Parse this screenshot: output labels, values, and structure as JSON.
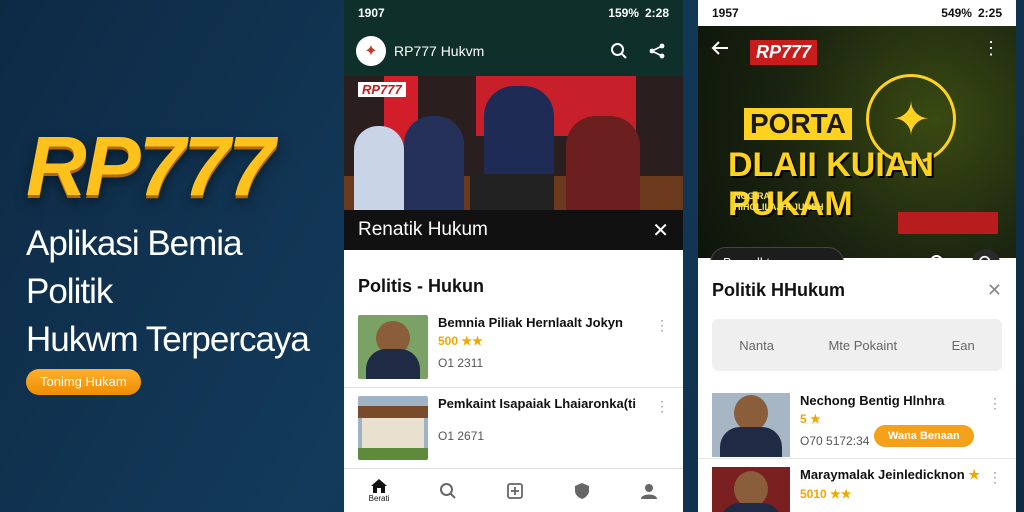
{
  "hero": {
    "logo": "RP777",
    "tagline_line1": "Aplikasi Bemia Politik",
    "tagline_line2": "Hukwm Terpercaya",
    "button": "Tonimg Hukam"
  },
  "phone1": {
    "status_time": "1907",
    "status_right": "159%",
    "status_clock": "2:28",
    "app_title": "RP777 Hukvm",
    "image_sign": "RP777",
    "caption": "Renatik Hukum",
    "list_title": "Politis - Hukun",
    "items": [
      {
        "title": "Bemnia Piliak Hernlaalt Jokyn",
        "rating": "500",
        "meta": "O1 2311"
      },
      {
        "title": "Pemkaint Isapaiak Lhaiaronka(ti",
        "rating": "",
        "meta": "O1 2671"
      }
    ],
    "nav": [
      "Berati",
      "",
      "",
      "",
      ""
    ]
  },
  "phone2": {
    "status_time": "1957",
    "status_right": "549%",
    "status_clock": "2:25",
    "logo": "RP777",
    "banner_porta": "PORTA",
    "banner_main": "DLAII KUIAN PUKAM",
    "banner_small1": "NOGIRA",
    "banner_small2": "HIHOLILAJHI JUNEH",
    "search_label": "Berocll tava",
    "panel_title": "Politik HHukum",
    "segments": [
      "Nanta",
      "Mte Pokaint",
      "Ean"
    ],
    "items": [
      {
        "title": "Nechong Bentig Hlnhra",
        "rating": "5",
        "meta": "O70 5172:34",
        "button": "Wana Benaan"
      },
      {
        "title": "Maraymalak Jeinledicknon",
        "rating": "5010",
        "meta": ""
      }
    ]
  }
}
